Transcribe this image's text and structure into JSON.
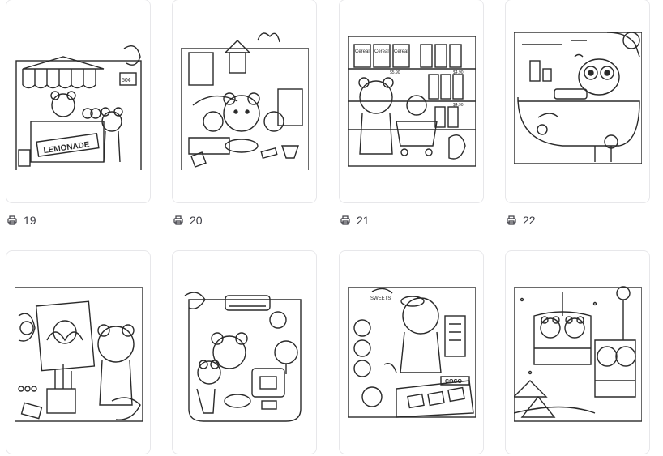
{
  "cards": [
    {
      "id": "c1",
      "name": "lemonade-stand",
      "count": "19",
      "sign": "LEMONADE",
      "price": "50¢"
    },
    {
      "id": "c2",
      "name": "living-room",
      "count": "20"
    },
    {
      "id": "c3",
      "name": "grocery-store",
      "count": "21",
      "labels": [
        "Cereal",
        "Cereal",
        "Cereal"
      ],
      "prices": [
        "$5.90",
        "$4.90",
        "$4.90"
      ]
    },
    {
      "id": "c4",
      "name": "bathtub",
      "count": "22"
    },
    {
      "id": "c5",
      "name": "painting",
      "count": ""
    },
    {
      "id": "c6",
      "name": "gaming-room",
      "count": ""
    },
    {
      "id": "c7",
      "name": "candy-shop",
      "count": "",
      "signs": [
        "SWEETS",
        "COCO"
      ]
    },
    {
      "id": "c8",
      "name": "ski-lift",
      "count": ""
    }
  ],
  "icons": {
    "print": "printer-icon"
  },
  "colors": {
    "border": "#e7e7ea",
    "text": "#3c3c44",
    "lineart": "#2a2a2a"
  }
}
